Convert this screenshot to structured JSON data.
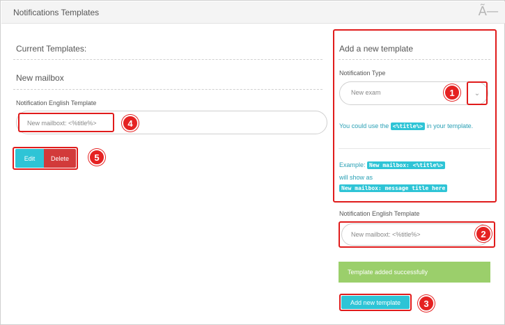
{
  "window": {
    "title": "Notifications Templates",
    "font_icon": "Ã—"
  },
  "left": {
    "current_templates_label": "Current Templates:",
    "template_name": "New mailbox",
    "field_label": "Notification English Template",
    "field_value": "New mailboxt: <%title%>",
    "edit_label": "Edit",
    "delete_label": "Delete"
  },
  "right": {
    "heading": "Add a new template",
    "type_label": "Notification Type",
    "type_selected": "New exam",
    "use_prefix": "You could use the",
    "use_code": "<%title%>",
    "use_suffix": "in your template.",
    "example_prefix": "Example:",
    "example_code": "New mailbox: <%title%>",
    "will_show": "will show as",
    "result_code": "New mailbox: message title here",
    "field_label": "Notification English Template",
    "field_placeholder": "New mailboxt: <%title%>",
    "success_message": "Template added successfully",
    "add_button": "Add new template"
  },
  "annotations": {
    "badge1": "1",
    "badge2": "2",
    "badge3": "3",
    "badge4": "4",
    "badge5": "5"
  },
  "colors": {
    "accent": "#2ec4d6",
    "danger": "#d23a3a",
    "success": "#9bcf6b",
    "annotation_red": "#e01b1b"
  }
}
